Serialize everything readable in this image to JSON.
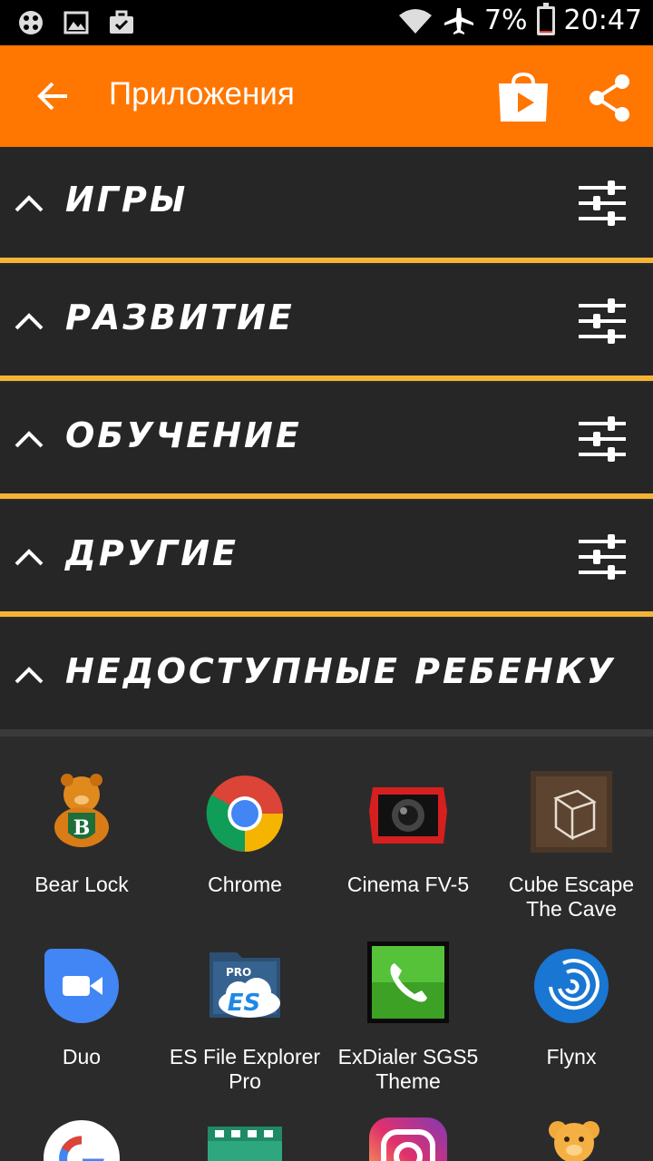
{
  "status_bar": {
    "battery": "7%",
    "time": "20:47",
    "battery_level": 0.07
  },
  "app_bar": {
    "title": "Приложения",
    "color": "#ff7600"
  },
  "categories": [
    {
      "label": "ИГРЫ"
    },
    {
      "label": "РАЗВИТИЕ"
    },
    {
      "label": "ОБУЧЕНИЕ"
    },
    {
      "label": "ДРУГИЕ"
    },
    {
      "label": "НЕДОСТУПНЫЕ РЕБЕНКУ"
    }
  ],
  "apps": [
    {
      "label": "Bear Lock",
      "icon": "bear-lock-icon"
    },
    {
      "label": "Chrome",
      "icon": "chrome-icon"
    },
    {
      "label": "Cinema FV-5",
      "icon": "cinema-fv5-icon"
    },
    {
      "label": "Cube Escape The Cave",
      "icon": "cube-escape-icon"
    },
    {
      "label": "Duo",
      "icon": "duo-icon"
    },
    {
      "label": "ES File Explorer Pro",
      "icon": "es-file-explorer-icon"
    },
    {
      "label": "ExDialer SGS5 Theme",
      "icon": "exdialer-icon"
    },
    {
      "label": "Flynx",
      "icon": "flynx-icon"
    },
    {
      "label": "",
      "icon": "google-icon"
    },
    {
      "label": "",
      "icon": "video-app-icon"
    },
    {
      "label": "",
      "icon": "instagram-icon"
    },
    {
      "label": "",
      "icon": "teddy-bear-icon"
    }
  ],
  "colors": {
    "accent": "#ff7600",
    "separator": "#f5b335",
    "category_bg": "#262626",
    "grid_bg": "#2b2b2b"
  }
}
